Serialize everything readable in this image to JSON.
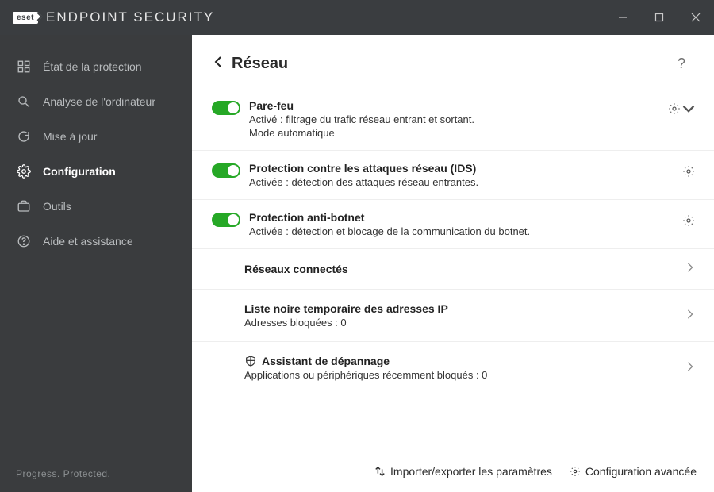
{
  "brand": {
    "logo_text": "eset",
    "product_name": "ENDPOINT SECURITY"
  },
  "window_controls": {
    "minimize": "minimize",
    "maximize": "maximize",
    "close": "close"
  },
  "sidebar": {
    "items": [
      {
        "label": "État de la protection",
        "icon": "grid-status-icon"
      },
      {
        "label": "Analyse de l'ordinateur",
        "icon": "magnifier-icon"
      },
      {
        "label": "Mise à jour",
        "icon": "refresh-icon"
      },
      {
        "label": "Configuration",
        "icon": "gear-icon",
        "active": true
      },
      {
        "label": "Outils",
        "icon": "briefcase-icon"
      },
      {
        "label": "Aide et assistance",
        "icon": "help-circle-icon"
      }
    ],
    "footer": "Progress. Protected."
  },
  "page": {
    "title": "Réseau",
    "help_tooltip": "?",
    "modules": [
      {
        "title": "Pare-feu",
        "status_prefix": "Activé :",
        "status_text": "filtrage du trafic réseau entrant et sortant.",
        "extra": "Mode automatique",
        "enabled": true,
        "action": "gear-dropdown"
      },
      {
        "title": "Protection contre les attaques réseau (IDS)",
        "status_prefix": "Activée :",
        "status_text": "détection des attaques réseau entrantes.",
        "enabled": true,
        "action": "gear"
      },
      {
        "title": "Protection anti-botnet",
        "status_prefix": "Activée :",
        "status_text": "détection et blocage de la communication du botnet.",
        "enabled": true,
        "action": "gear"
      }
    ],
    "links": [
      {
        "title": "Réseaux connectés"
      },
      {
        "title": "Liste noire temporaire des adresses IP",
        "sub": "Adresses bloquées : 0"
      },
      {
        "title": "Assistant de dépannage",
        "sub": "Applications ou périphériques récemment bloqués : 0",
        "icon": "shield-icon"
      }
    ]
  },
  "bottom": {
    "import_export": "Importer/exporter les paramètres",
    "advanced": "Configuration avancée"
  }
}
